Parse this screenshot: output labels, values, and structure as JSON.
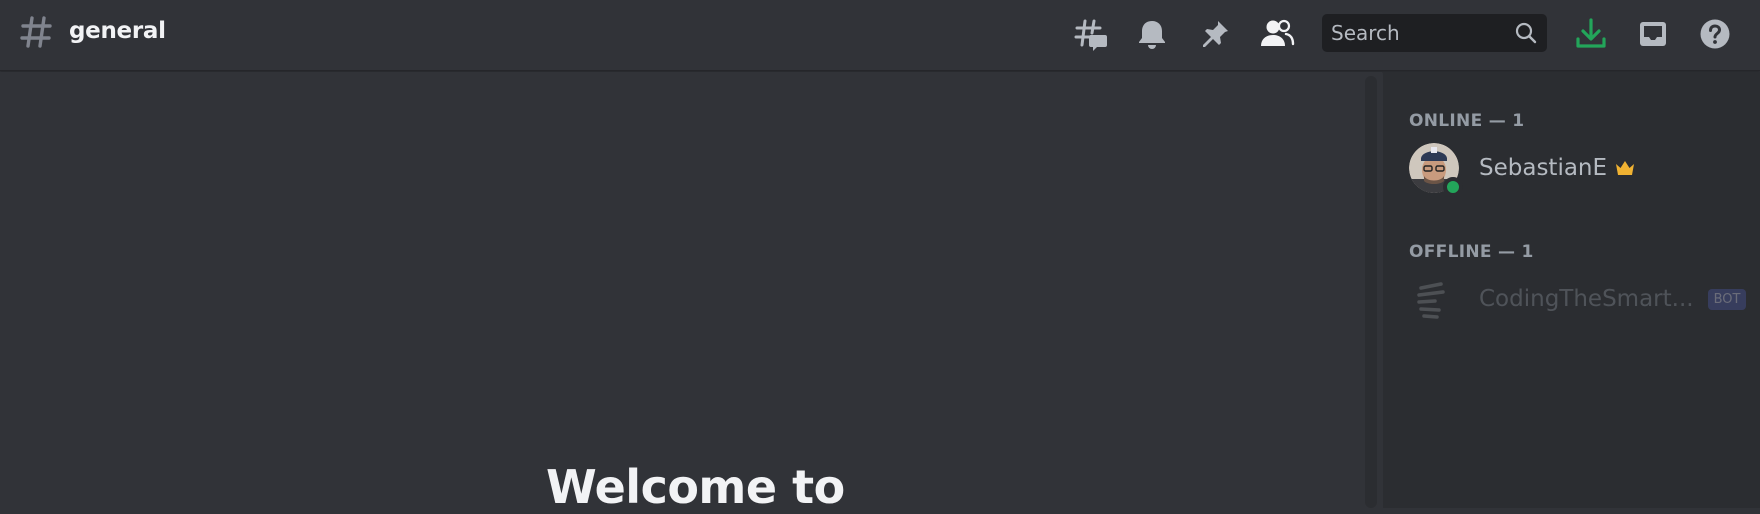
{
  "header": {
    "channel_name": "general",
    "search_placeholder": "Search",
    "icons": [
      "threads-icon",
      "bell-icon",
      "pin-icon",
      "members-icon",
      "search-icon",
      "download-icon",
      "inbox-icon",
      "help-icon"
    ]
  },
  "chat": {
    "welcome_text": "Welcome to"
  },
  "members": {
    "online_title": "ONLINE — 1",
    "offline_title": "OFFLINE — 1",
    "online": [
      {
        "name": "SebastianE",
        "status": "online",
        "owner": true
      }
    ],
    "offline": [
      {
        "name": "CodingTheSmart...",
        "badge": "BOT"
      }
    ]
  },
  "colors": {
    "background": "#313338",
    "sidebar": "#2b2d31",
    "accent_green": "#23a55a",
    "crown": "#f0b232",
    "bot_badge": "#5865f2"
  }
}
